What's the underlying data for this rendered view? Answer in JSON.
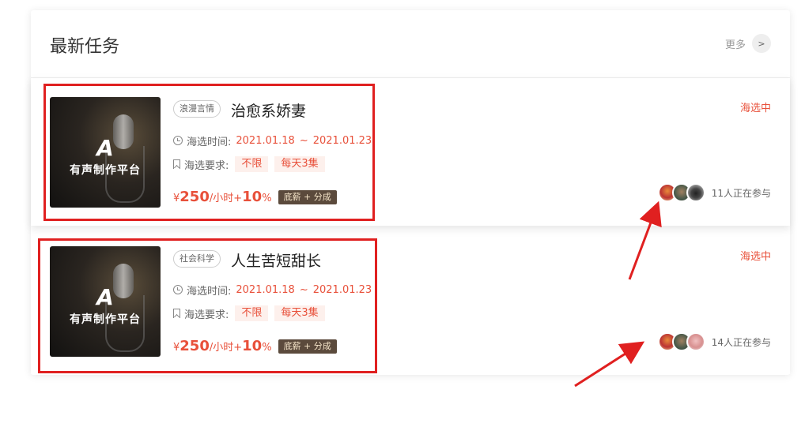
{
  "panel": {
    "title": "最新任务",
    "more_label": "更多",
    "more_icon": "chevron-right-icon",
    "more_glyph": ">"
  },
  "tasks": [
    {
      "cover": {
        "logo": "A",
        "text": "有声制作平台"
      },
      "tag": "浪漫言情",
      "name": "治愈系娇妻",
      "time_label": "海选时间:",
      "date_start": "2021.01.18",
      "date_sep": "~",
      "date_end": "2021.01.23",
      "req_label": "海选要求:",
      "req_chips": [
        "不限",
        "每天3集"
      ],
      "price": {
        "currency": "¥",
        "amount": "250",
        "unit": "/小时+",
        "percent": "10",
        "percent_sign": "%"
      },
      "salary_tag": "底薪 + 分成",
      "status": "海选中",
      "participants_text": "11人正在参与"
    },
    {
      "cover": {
        "logo": "A",
        "text": "有声制作平台"
      },
      "tag": "社会科学",
      "name": "人生苦短甜长",
      "time_label": "海选时间:",
      "date_start": "2021.01.18",
      "date_sep": "~",
      "date_end": "2021.01.23",
      "req_label": "海选要求:",
      "req_chips": [
        "不限",
        "每天3集"
      ],
      "price": {
        "currency": "¥",
        "amount": "250",
        "unit": "/小时+",
        "percent": "10",
        "percent_sign": "%"
      },
      "salary_tag": "底薪 + 分成",
      "status": "海选中",
      "participants_text": "14人正在参与"
    }
  ],
  "colors": {
    "accent": "#e8503a",
    "annotation": "#e02020",
    "salary_bg": "#5b4a3c"
  }
}
